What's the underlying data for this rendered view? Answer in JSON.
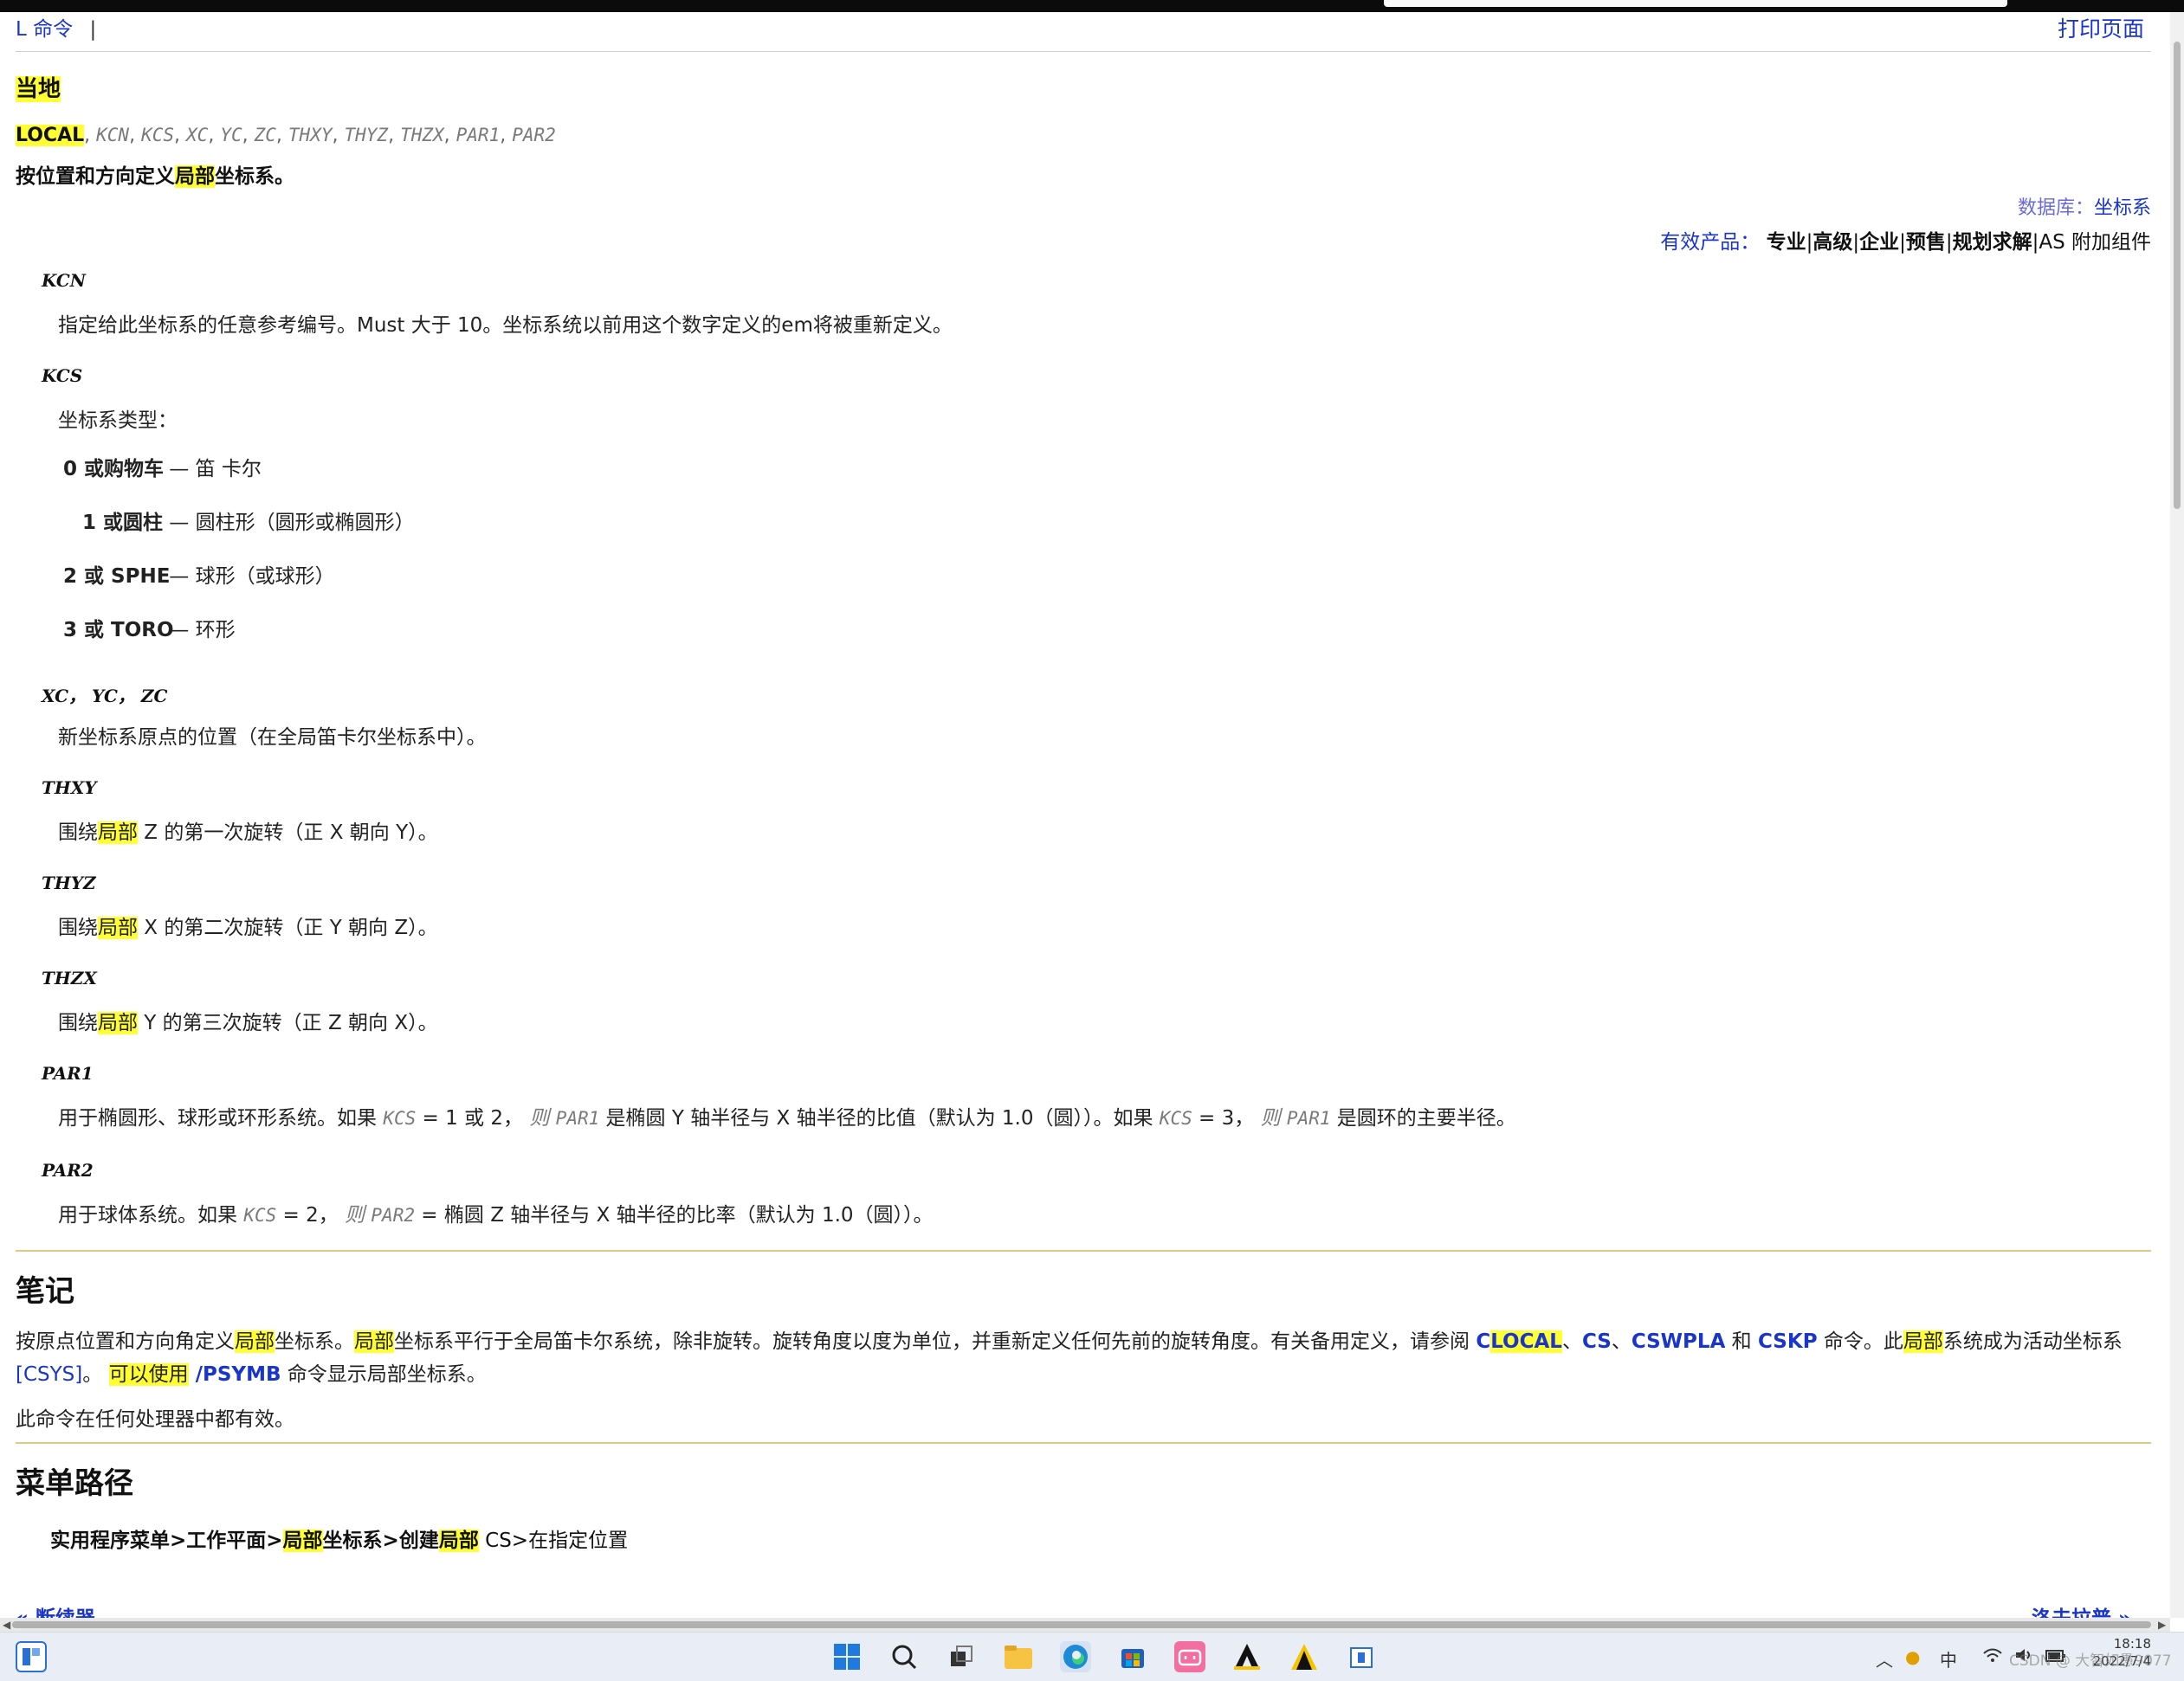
{
  "breadcrumb": {
    "link": "L 命令",
    "separator": "|"
  },
  "print_link": "打印页面",
  "title": "当地",
  "syntax": {
    "command": "LOCAL",
    "args": [
      "KCN",
      "KCS",
      "XC",
      "YC",
      "ZC",
      "THXY",
      "THYZ",
      "THZX",
      "PAR1",
      "PAR2"
    ]
  },
  "subtitle_pre": "按位置和方向定义",
  "subtitle_hl": "局部",
  "subtitle_post": "坐标系。",
  "database": {
    "label": "数据库：",
    "link": "坐标系"
  },
  "products": {
    "label": "有效产品：",
    "items": [
      "专业",
      "高级",
      "企业",
      "预售",
      "规划求解"
    ],
    "suffix": "AS 附加组件"
  },
  "params": {
    "kcn": {
      "name": "KCN",
      "desc": "指定给此坐标系的任意参考编号。Must 大于 10。坐标系统以前用这个数字定义的em将被重新定义。"
    },
    "kcs": {
      "name": "KCS",
      "desc": "坐标系类型：",
      "options": [
        {
          "key": "0 或购物车",
          "value": "笛 卡尔"
        },
        {
          "key": "1 或圆柱",
          "value": "圆柱形（圆形或椭圆形）"
        },
        {
          "key": "2 或 SPHE",
          "value": "球形（或球形）"
        },
        {
          "key": "3 或 TORO",
          "value": "环形"
        }
      ]
    },
    "xyz": {
      "name": "XC， YC， ZC",
      "desc": "新坐标系原点的位置（在全局笛卡尔坐标系中）。"
    },
    "thxy": {
      "name": "THXY",
      "pre": "围绕",
      "hl": "局部",
      "post": " Z 的第一次旋转（正 X 朝向 Y）。"
    },
    "thyz": {
      "name": "THYZ",
      "pre": "围绕",
      "hl": "局部",
      "post": " X 的第二次旋转（正 Y 朝向 Z）。"
    },
    "thzx": {
      "name": "THZX",
      "pre": "围绕",
      "hl": "局部",
      "post": " Y 的第三次旋转（正 Z 朝向 X）。"
    },
    "par1": {
      "name": "PAR1",
      "p1": "用于椭圆形、球形或环形系统。如果 ",
      "kcs": "KCS",
      "p2": " = 1 或 2，",
      "then": "则",
      "par": "PAR1",
      "p3": " 是椭圆 Y 轴半径与 X 轴半径的比值（默认为 1.0（圆））。如果 ",
      "p4": " = 3，",
      "p5": " 是圆环的主要半径。"
    },
    "par2": {
      "name": "PAR2",
      "p1": "用于球体系统。如果 ",
      "kcs": "KCS",
      "p2": " = 2，",
      "then": "则",
      "par": "PAR2",
      "p3": " = 椭圆 Z 轴半径与 X 轴半径的比率（默认为 1.0（圆））。"
    }
  },
  "notes": {
    "heading": "笔记",
    "t1": "按原点位置和方向角定义",
    "hl": "局部",
    "t2": "坐标系。",
    "t3": "坐标系平行于全局笛卡尔系统，除非旋转。旋转角度以度为单位，并重新定义任何先前的旋转角度。有关备用定义，请参阅 ",
    "clocal_c": "C",
    "clocal_hl": "LOCAL",
    "sep1": "、",
    "cs": "CS",
    "sep2": "、",
    "cswpla": "CSWPLA",
    "and": " 和 ",
    "cskp": "CSKP",
    "t4": " 命令。此",
    "t5": "系统成为活动坐标系",
    "csys": "[CSYS]",
    "t6": "。",
    "can": "可以使用",
    "psymb": " /PSYMB",
    "t7": " 命令显示局部坐标系。",
    "processor": "此命令在任何处理器中都有效。"
  },
  "menu": {
    "heading": "菜单路径",
    "p1": "实用程序菜单>工作平面>",
    "hl": "局部",
    "p2": "坐标系>创建",
    "p3": " CS>在指定位置"
  },
  "footer_nav": {
    "prev": "« 断续器",
    "next": "洛夫拉普 »"
  },
  "taskbar": {
    "tray_ime": "中",
    "time": "18:18",
    "date": "2022/7/4",
    "watermark": "CSDN @ 大智如愚9077"
  }
}
